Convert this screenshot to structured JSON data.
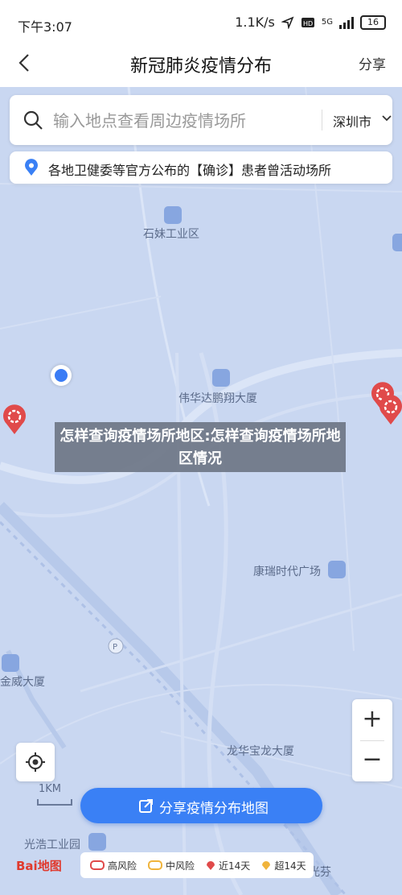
{
  "status_bar": {
    "time": "下午3:07",
    "speed": "1.1K/s",
    "network": "5G",
    "battery": "16"
  },
  "nav": {
    "title": "新冠肺炎疫情分布",
    "share_label": "分享"
  },
  "search": {
    "placeholder": "输入地点查看周边疫情场所",
    "city": "深圳市"
  },
  "info_banner": {
    "text": "各地卫健委等官方公布的【确诊】患者曾活动场所"
  },
  "map": {
    "pois": [
      "石妹工业区",
      "伟华达鹏翔大厦",
      "康瑞时代广场",
      "金威大厦",
      "龙华宝龙大厦",
      "光浩工业园",
      "光芬"
    ],
    "scale_label": "1KM"
  },
  "overlay": {
    "title": "怎样查询疫情场所地区:怎样查询疫情场所地区情况"
  },
  "controls": {
    "zoom_in": "+",
    "zoom_out": "−"
  },
  "share_button": {
    "label": "分享疫情分布地图"
  },
  "branding": {
    "logo_text": "Bai地图"
  },
  "legend": {
    "high": "高风险",
    "mid": "中风险",
    "recent14": "近14天",
    "over14": "超14天"
  },
  "colors": {
    "accent": "#3a80f5",
    "high_risk": "#e04a4a",
    "mid_risk": "#f0b43c",
    "map_bg": "#c9d7f1"
  }
}
